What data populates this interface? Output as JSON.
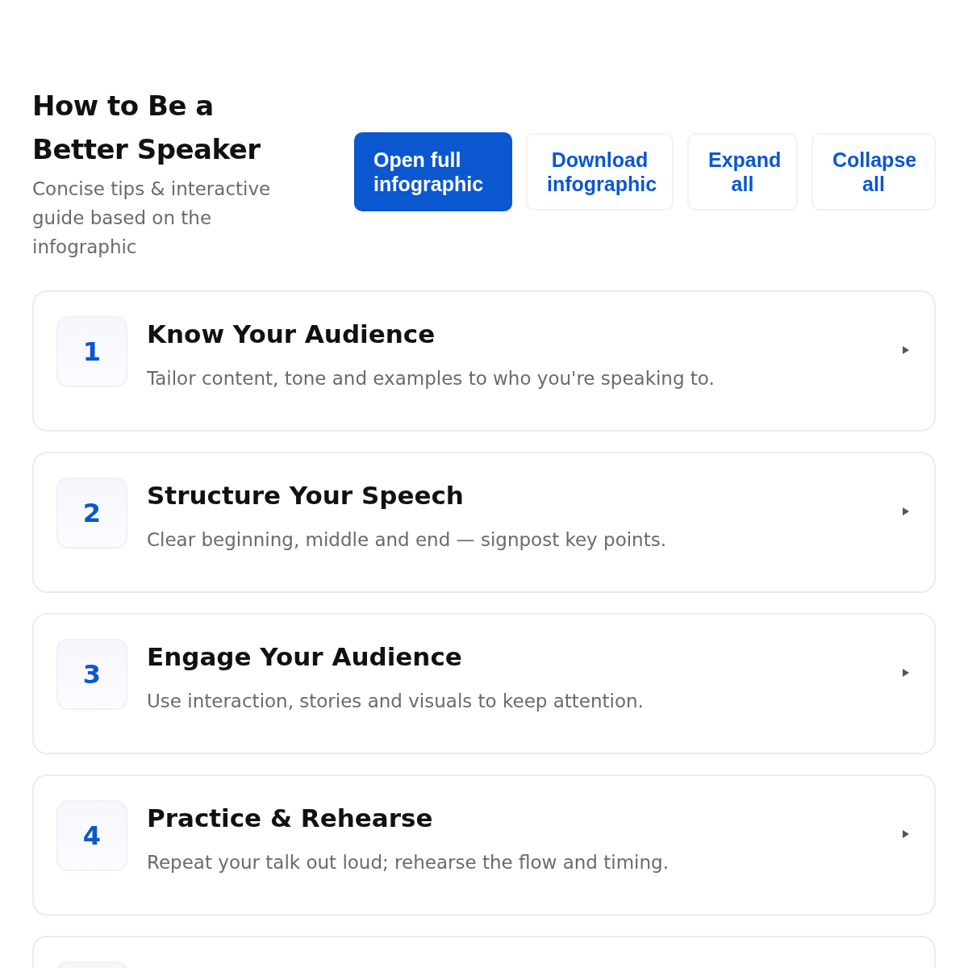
{
  "header": {
    "title": "How to Be a Better Speaker",
    "subtitle": "Concise tips & interactive guide based on the infographic"
  },
  "actions": [
    {
      "label": "Open full infographic",
      "kind": "primary"
    },
    {
      "label": "Download infographic",
      "kind": "secondary"
    },
    {
      "label": "Expand all",
      "kind": "secondary"
    },
    {
      "label": "Collapse all",
      "kind": "secondary"
    }
  ],
  "tips": [
    {
      "kind": "full",
      "number": "1",
      "title": "Know Your Audience",
      "description": "Tailor content, tone and examples to who you're speaking to.",
      "expanded": false
    },
    {
      "kind": "full",
      "number": "2",
      "title": "Structure Your Speech",
      "description": "Clear beginning, middle and end — signpost key points.",
      "expanded": false
    },
    {
      "kind": "full",
      "number": "3",
      "title": "Engage Your Audience",
      "description": "Use interaction, stories and visuals to keep attention.",
      "expanded": false
    },
    {
      "kind": "full",
      "number": "4",
      "title": "Practice & Rehearse",
      "description": "Repeat your talk out loud; rehearse the flow and timing.",
      "expanded": false
    },
    {
      "kind": "partial"
    }
  ]
}
